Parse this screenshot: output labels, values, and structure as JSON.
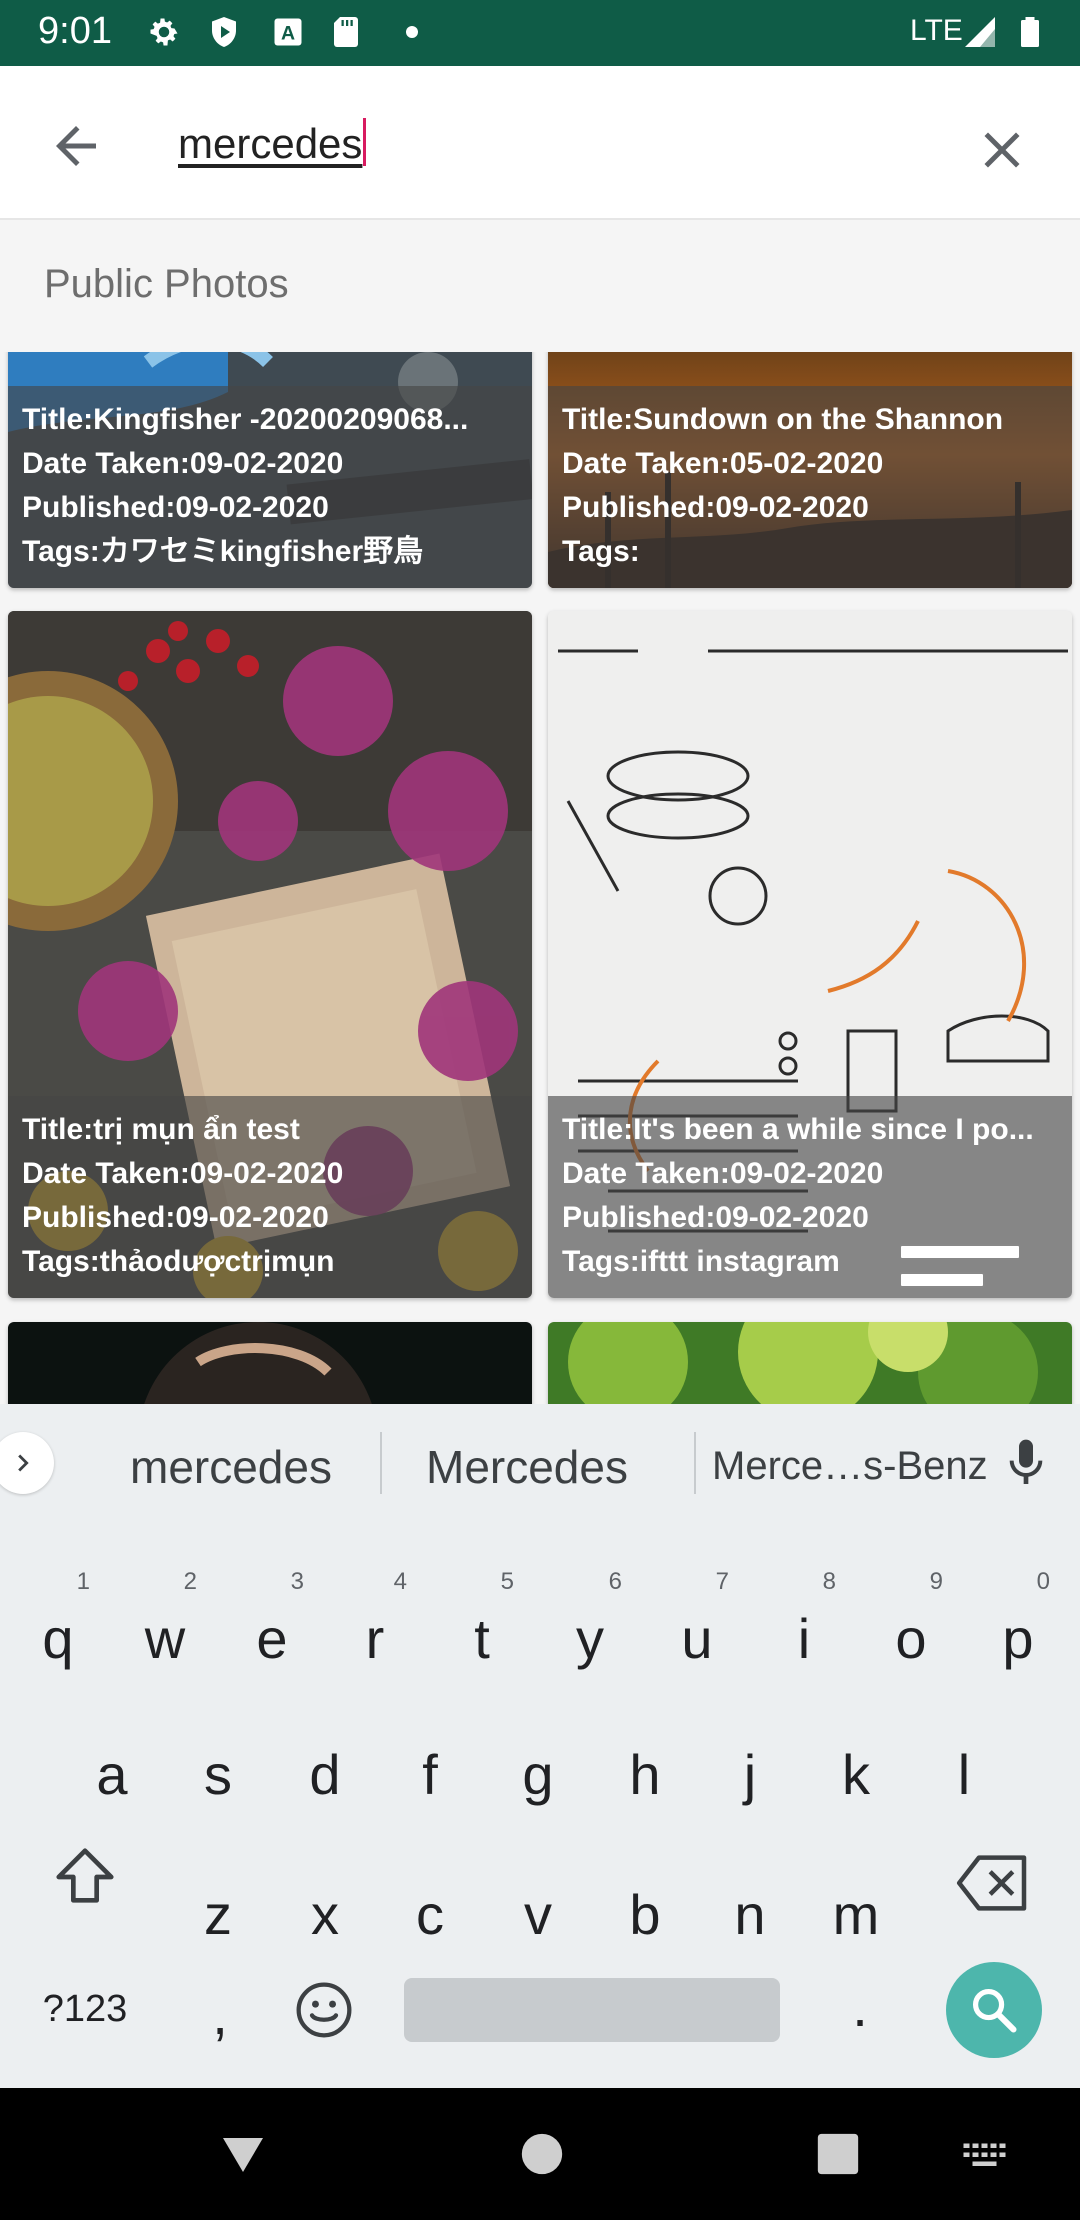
{
  "status_bar": {
    "time": "9:01",
    "network": "LTE",
    "icons": [
      "settings-icon",
      "shield-play-icon",
      "font-a-icon",
      "sd-card-icon",
      "dot-icon",
      "signal-icon",
      "battery-icon"
    ]
  },
  "search": {
    "query": "mercedes"
  },
  "section": {
    "label": "Public Photos"
  },
  "photos": [
    {
      "title": "Title:Kingfisher -20200209068...",
      "date_taken": "Date Taken:09-02-2020",
      "published": "Published:09-02-2020",
      "tags": "Tags:カワセミkingfisher野鳥"
    },
    {
      "title": "Title:Sundown on the Shannon",
      "date_taken": "Date Taken:05-02-2020",
      "published": "Published:09-02-2020",
      "tags": "Tags:"
    },
    {
      "title": "Title:trị mụn ẩn test",
      "date_taken": "Date Taken:09-02-2020",
      "published": "Published:09-02-2020",
      "tags": "Tags:thảodượctrịmụn"
    },
    {
      "title": "Title:It's been a while since I po...",
      "date_taken": "Date Taken:09-02-2020",
      "published": "Published:09-02-2020",
      "tags": "Tags:ifttt instagram"
    },
    {
      "title": "",
      "date_taken": "",
      "published": "",
      "tags": ""
    },
    {
      "title": "",
      "date_taken": "",
      "published": "",
      "tags": ""
    }
  ],
  "keyboard": {
    "suggestions": [
      "mercedes",
      "Mercedes",
      "Merce…s-Benz"
    ],
    "row1": [
      "q",
      "w",
      "e",
      "r",
      "t",
      "y",
      "u",
      "i",
      "o",
      "p"
    ],
    "row1_hints": [
      "1",
      "2",
      "3",
      "4",
      "5",
      "6",
      "7",
      "8",
      "9",
      "0"
    ],
    "row2": [
      "a",
      "s",
      "d",
      "f",
      "g",
      "h",
      "j",
      "k",
      "l"
    ],
    "row3": [
      "z",
      "x",
      "c",
      "v",
      "b",
      "n",
      "m"
    ],
    "symbols_label": "?123",
    "comma": ",",
    "period": "."
  },
  "colors": {
    "status_bar": "#0f5c47",
    "cursor": "#d81b60",
    "search_key": "#4db6ac"
  }
}
